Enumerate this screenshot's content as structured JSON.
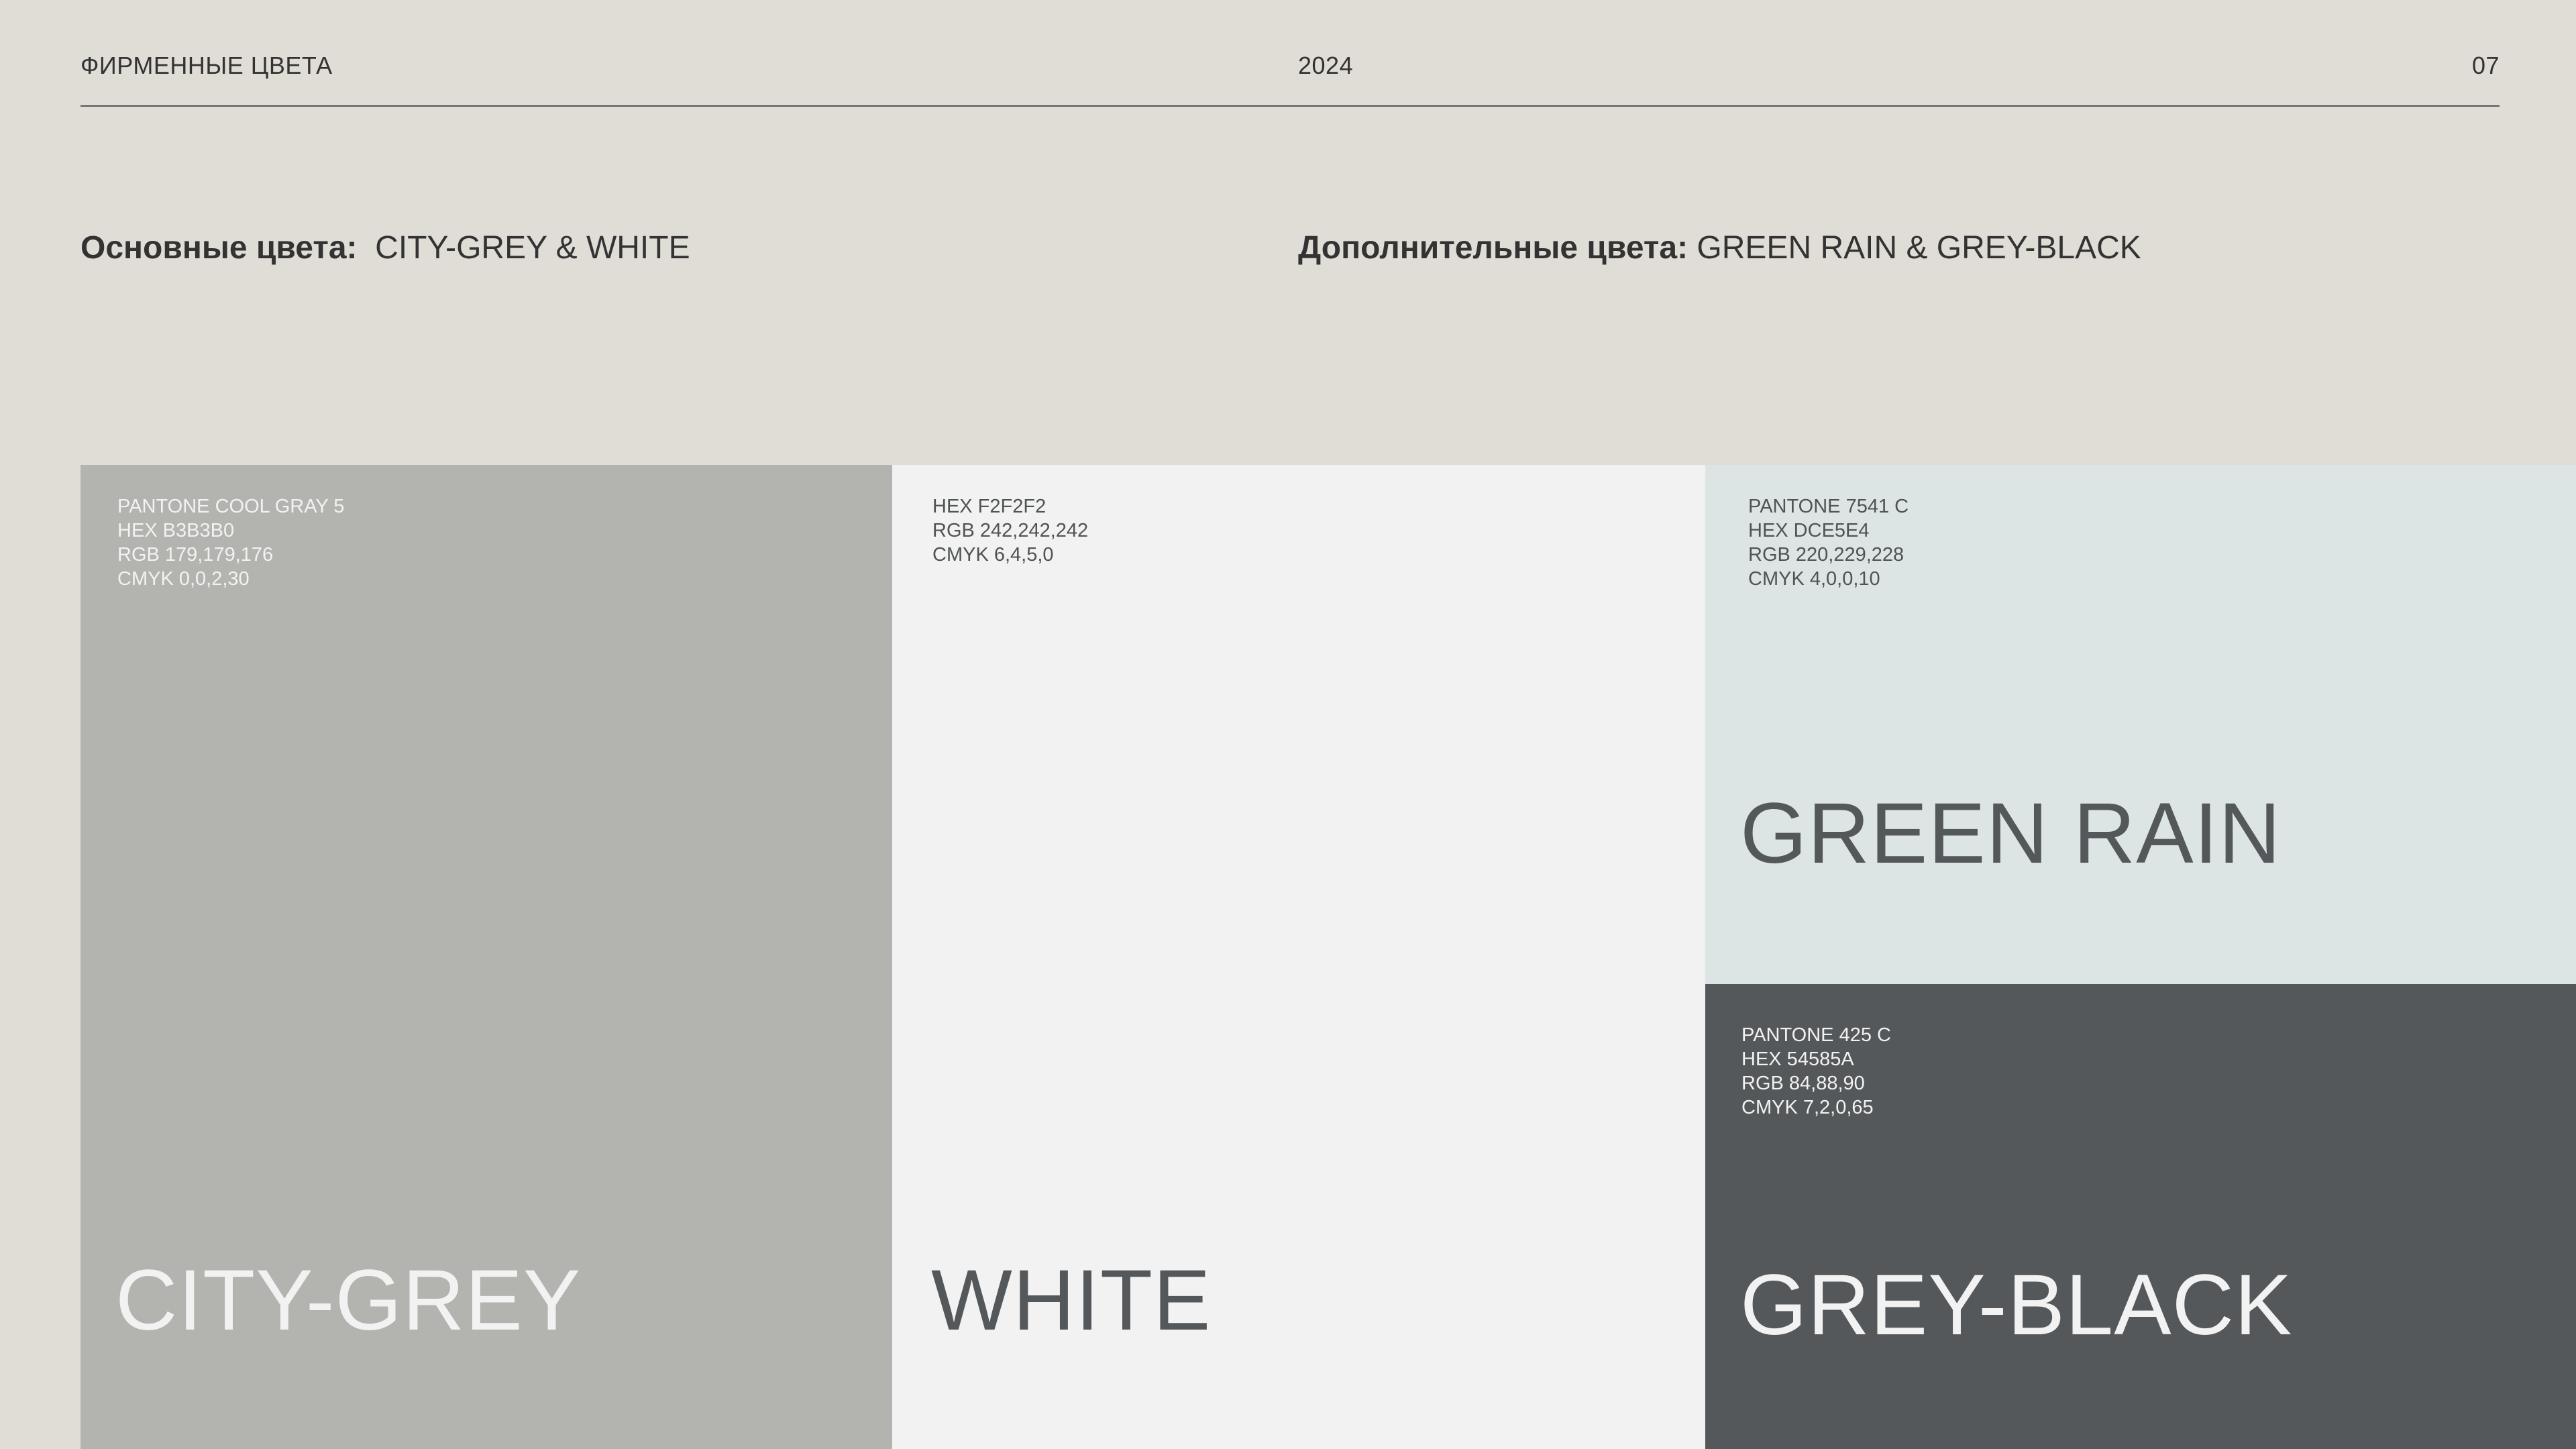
{
  "header": {
    "section_title": "ФИРМЕННЫЕ ЦВЕТА",
    "year": "2024",
    "page_number": "07"
  },
  "subheadings": {
    "primary": {
      "label": "Основные цвета:",
      "value": "CITY-GREY & WHITE"
    },
    "secondary": {
      "label": "Дополнительные цвета:",
      "value": "GREEN RAIN & GREY-BLACK"
    }
  },
  "colors": {
    "city_grey": {
      "name": "CITY-GREY",
      "swatch_color": "#B3B3B0",
      "specs": [
        "PANTONE COOL GRAY 5",
        "HEX  B3B3B0",
        "RGB 179,179,176",
        "CMYK 0,0,2,30"
      ]
    },
    "white": {
      "name": "WHITE",
      "swatch_color": "#F2F2F2",
      "specs": [
        "HEX F2F2F2",
        "RGB 242,242,242",
        "CMYK 6,4,5,0"
      ]
    },
    "green_rain": {
      "name": "GREEN RAIN",
      "swatch_color": "#DCE5E4",
      "specs": [
        "PANTONE 7541 C",
        "HEX DCE5E4",
        "RGB 220,229,228",
        "CMYK 4,0,0,10"
      ]
    },
    "grey_black": {
      "name": "GREY-BLACK",
      "swatch_color": "#54585A",
      "specs": [
        "PANTONE 425 C",
        "HEX 54585A",
        "RGB  84,88,90",
        "CMYK 7,2,0,65"
      ]
    }
  },
  "page_background": "#E0DDD6",
  "text_color": "#333333"
}
